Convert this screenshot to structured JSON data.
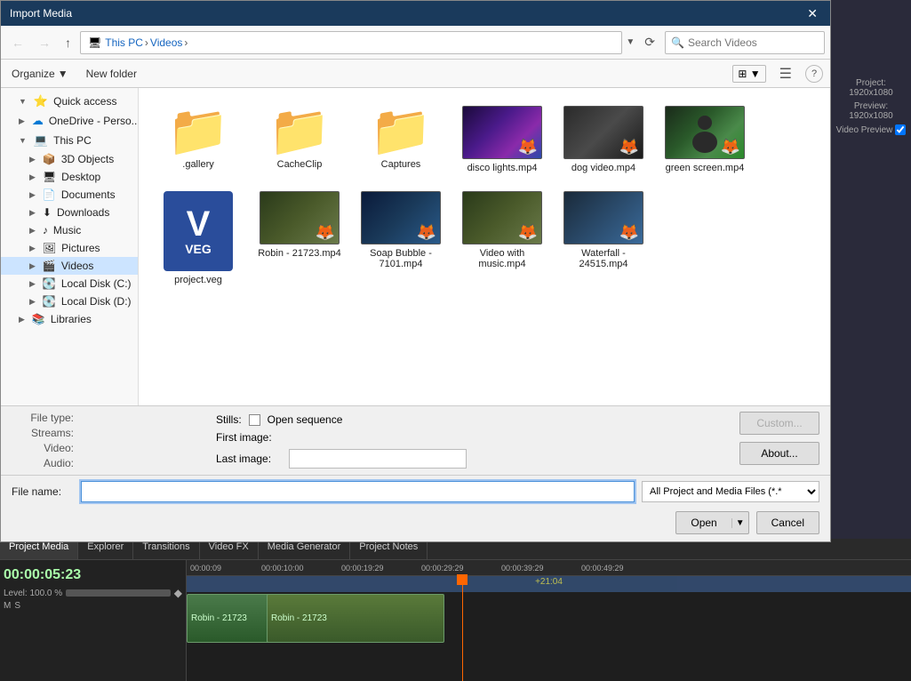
{
  "dialog": {
    "title": "Import Media",
    "close_label": "✕"
  },
  "address_bar": {
    "back_label": "←",
    "forward_label": "→",
    "up_label": "↑",
    "path_parts": [
      "This PC",
      "Videos"
    ],
    "refresh_label": "⟳",
    "search_placeholder": "Search Videos",
    "dropdown_label": "▼"
  },
  "toolbar": {
    "organize_label": "Organize",
    "organize_arrow": "▼",
    "new_folder_label": "New folder",
    "view_label": "⊞",
    "view_arrow": "▼",
    "details_label": "☰",
    "help_label": "?"
  },
  "sidebar": {
    "items": [
      {
        "id": "quick-access",
        "label": "Quick access",
        "indent": 1,
        "expanded": true,
        "icon": "⭐",
        "icon_color": "#f5a623"
      },
      {
        "id": "onedrive",
        "label": "OneDrive - Perso...",
        "indent": 1,
        "expanded": false,
        "icon": "☁",
        "icon_color": "#0078d4"
      },
      {
        "id": "this-pc",
        "label": "This PC",
        "indent": 1,
        "expanded": true,
        "icon": "💻",
        "icon_color": "#555"
      },
      {
        "id": "3d-objects",
        "label": "3D Objects",
        "indent": 2,
        "expanded": false,
        "icon": "📦",
        "icon_color": "#888"
      },
      {
        "id": "desktop",
        "label": "Desktop",
        "indent": 2,
        "expanded": false,
        "icon": "🖥",
        "icon_color": "#888"
      },
      {
        "id": "documents",
        "label": "Documents",
        "indent": 2,
        "expanded": false,
        "icon": "📄",
        "icon_color": "#888"
      },
      {
        "id": "downloads",
        "label": "Downloads",
        "indent": 2,
        "expanded": false,
        "icon": "⬇",
        "icon_color": "#888"
      },
      {
        "id": "music",
        "label": "Music",
        "indent": 2,
        "expanded": false,
        "icon": "♪",
        "icon_color": "#888"
      },
      {
        "id": "pictures",
        "label": "Pictures",
        "indent": 2,
        "expanded": false,
        "icon": "🖼",
        "icon_color": "#888"
      },
      {
        "id": "videos",
        "label": "Videos",
        "indent": 2,
        "expanded": false,
        "icon": "🎬",
        "icon_color": "#555",
        "selected": true
      },
      {
        "id": "local-c",
        "label": "Local Disk (C:)",
        "indent": 2,
        "expanded": false,
        "icon": "💽",
        "icon_color": "#888"
      },
      {
        "id": "local-d",
        "label": "Local Disk (D:)",
        "indent": 2,
        "expanded": false,
        "icon": "💽",
        "icon_color": "#888"
      },
      {
        "id": "libraries",
        "label": "Libraries",
        "indent": 1,
        "expanded": false,
        "icon": "📚",
        "icon_color": "#888"
      }
    ]
  },
  "files": [
    {
      "id": "gallery",
      "name": ".gallery",
      "type": "folder"
    },
    {
      "id": "cacheclip",
      "name": "CacheClip",
      "type": "folder"
    },
    {
      "id": "captures",
      "name": "Captures",
      "type": "folder"
    },
    {
      "id": "disco",
      "name": "disco lights.mp4",
      "type": "video",
      "theme": "disco"
    },
    {
      "id": "dog",
      "name": "dog video.mp4",
      "type": "video",
      "theme": "dog"
    },
    {
      "id": "green",
      "name": "green screen.mp4",
      "type": "video",
      "theme": "green"
    },
    {
      "id": "project",
      "name": "project.veg",
      "type": "veg"
    },
    {
      "id": "robin",
      "name": "Robin - 21723.mp4",
      "type": "video",
      "theme": "robin"
    },
    {
      "id": "soap",
      "name": "Soap Bubble - 7101.mp4",
      "type": "video",
      "theme": "bubble"
    },
    {
      "id": "video-music",
      "name": "Video with music.mp4",
      "type": "video",
      "theme": "video"
    },
    {
      "id": "waterfall",
      "name": "Waterfall - 24515.mp4",
      "type": "video",
      "theme": "waterfall"
    }
  ],
  "bottom_panel": {
    "file_type_label": "File type:",
    "streams_label": "Streams:",
    "stills_label": "Stills:",
    "open_sequence_label": "Open sequence",
    "video_label": "Video:",
    "audio_label": "Audio:",
    "first_image_label": "First image:",
    "last_image_label": "Last image:",
    "custom_label": "Custom...",
    "about_label": "About...",
    "filename_label": "File name:",
    "filetype_value": "All Project and Media Files (*.*",
    "open_label": "Open",
    "open_drop": "▼",
    "cancel_label": "Cancel"
  },
  "timeline": {
    "tabs": [
      "Project Media",
      "Explorer",
      "Transitions",
      "Video FX",
      "Media Generator",
      "Project Notes"
    ],
    "active_tab": "Project Media",
    "timecode": "00:00:05:23",
    "level_label": "Level: 100.0 %",
    "time_marks": [
      "00:00:09",
      "00:00:10:00",
      "00:00:19:29",
      "00:00:29:29",
      "00:00:39:29",
      "00:00:49:29"
    ],
    "clip_label_1": "Robin - 21723",
    "clip_label_2": "Robin - 21723",
    "timeline_badge": "+21:04",
    "project_info": "Project: 1920x1080",
    "preview_info": "Preview: 1920x1080",
    "video_preview": "Video Preview"
  }
}
